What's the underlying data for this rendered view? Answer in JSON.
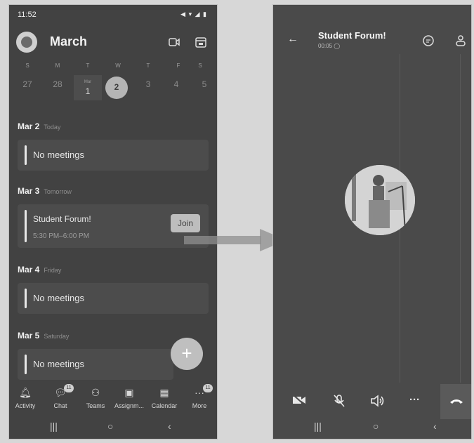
{
  "left": {
    "status": {
      "time": "11:52"
    },
    "header": {
      "month": "March",
      "icons": [
        "video-call-icon",
        "calendar-view-icon"
      ]
    },
    "week": {
      "weekdays": [
        "S",
        "M",
        "T",
        "W",
        "T",
        "F",
        "S"
      ],
      "days": [
        "27",
        "28",
        "1",
        "2",
        "3",
        "4",
        "5"
      ],
      "current_month_label": "Mar"
    },
    "agenda": [
      {
        "date": "Mar 2",
        "sub": "Today",
        "text": "No meetings"
      },
      {
        "date": "Mar 3",
        "sub": "Tomorrow",
        "text": "Student Forum!",
        "time": "5:30 PM–6:00 PM",
        "action": "Join"
      },
      {
        "date": "Mar 4",
        "sub": "Friday",
        "text": "No meetings"
      },
      {
        "date": "Mar 5",
        "sub": "Saturday",
        "text": "No meetings"
      }
    ],
    "fab": {
      "label": "+"
    },
    "tabs": [
      {
        "label": "Activity",
        "icon": "bell-icon"
      },
      {
        "label": "Chat",
        "icon": "chat-icon",
        "badge": "11"
      },
      {
        "label": "Teams",
        "icon": "teams-icon"
      },
      {
        "label": "Assignm...",
        "icon": "assignments-icon"
      },
      {
        "label": "Calendar",
        "icon": "calendar-icon"
      },
      {
        "label": "More",
        "icon": "more-icon",
        "badge": "11"
      }
    ],
    "nav": [
      "|||",
      "○",
      "‹"
    ]
  },
  "right": {
    "title": "Student Forum!",
    "duration": "00:05",
    "controls": [
      "camera-off-icon",
      "mic-off-icon",
      "speaker-icon",
      "more-options-icon",
      "hang-up-icon"
    ],
    "nav": [
      "|||",
      "○",
      "‹"
    ]
  }
}
